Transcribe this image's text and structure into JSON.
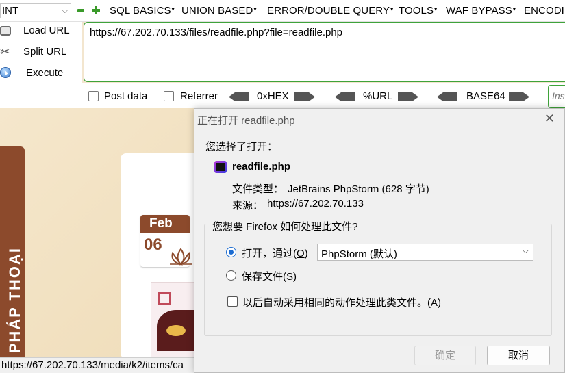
{
  "toolbar": {
    "select_value": "INT",
    "menus": [
      "SQL BASICS",
      "UNION BASED",
      "ERROR/DOUBLE QUERY",
      "TOOLS",
      "WAF BYPASS",
      "ENCODING"
    ],
    "actions": [
      "Load URL",
      "Split URL",
      "Execute"
    ],
    "url": "https://67.202.70.133/files/readfile.php?file=readfile.php",
    "post_data_label": "Post data",
    "referrer_label": "Referrer",
    "encodings": [
      "0xHEX",
      "%URL",
      "BASE64"
    ],
    "insert_placeholder": "Insert"
  },
  "page": {
    "vertical_tab": "PHÁP THOẠI",
    "date_month": "Feb",
    "date_day": "06",
    "status_url": "https://67.202.70.133/media/k2/items/ca"
  },
  "dialog": {
    "title": "正在打开 readfile.php",
    "prompt": "您选择了打开：",
    "file_name": "readfile.php",
    "type_label": "文件类型：",
    "type_value": "JetBrains PhpStorm (628 字节)",
    "source_label": "来源：",
    "source_value": "https://67.202.70.133",
    "question": "您想要 Firefox 如何处理此文件?",
    "open_with_label": "打开，通过(",
    "open_with_key": "O",
    "open_with_app": "PhpStorm (默认)",
    "save_label": "保存文件(",
    "save_key": "S",
    "remember_label": "以后自动采用相同的动作处理此类文件。(",
    "remember_key": "A",
    "ok_button": "确定",
    "cancel_button": "取消"
  },
  "colors": {
    "accent_green": "#3fa33a",
    "brand_brown": "#8c4a2c",
    "radio_blue": "#1a6bd1"
  }
}
